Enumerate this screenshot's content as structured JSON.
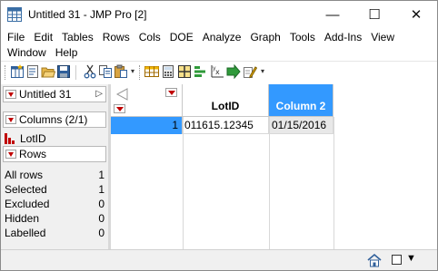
{
  "window": {
    "title": "Untitled 31 - JMP Pro [2]",
    "controls": {
      "minimize": "—",
      "maximize": "☐",
      "close": "✕"
    }
  },
  "menu": {
    "row1": [
      "File",
      "Edit",
      "Tables",
      "Rows",
      "Cols",
      "DOE",
      "Analyze",
      "Graph",
      "Tools",
      "Add-Ins",
      "View"
    ],
    "row2": [
      "Window",
      "Help"
    ]
  },
  "toolbar": {
    "group1": [
      "new-table-icon",
      "new-script-icon",
      "open-icon",
      "save-icon"
    ],
    "group2": [
      "cut-icon",
      "copy-icon",
      "paste-icon"
    ],
    "group3": [
      "data-table-icon",
      "calculator-icon",
      "grid-icon",
      "distribution-icon",
      "fit-y-by-x-icon",
      "fit-model-icon",
      "edit-icon"
    ],
    "more_glyph": "▾"
  },
  "left": {
    "table_panel": {
      "label": "Untitled 31",
      "arrow": "▷"
    },
    "columns_panel": {
      "label": "Columns (2/1)"
    },
    "column_items": [
      {
        "label": "LotID",
        "icon": "nominal-column-icon"
      }
    ],
    "rows_panel": {
      "label": "Rows"
    },
    "row_states": [
      {
        "label": "All rows",
        "value": "1"
      },
      {
        "label": "Selected",
        "value": "1"
      },
      {
        "label": "Excluded",
        "value": "0"
      },
      {
        "label": "Hidden",
        "value": "0"
      },
      {
        "label": "Labelled",
        "value": "0"
      }
    ]
  },
  "grid": {
    "columns": [
      "LotID",
      "Column 2"
    ],
    "rows": [
      {
        "row_number": "1",
        "cells": [
          "011615.12345",
          "01/15/2016"
        ]
      }
    ],
    "colors": {
      "selected": "#3399ff",
      "row_selected": "#3399ff",
      "accent_red": "#c00000"
    }
  },
  "statusbar": {
    "arrow": "▼"
  }
}
